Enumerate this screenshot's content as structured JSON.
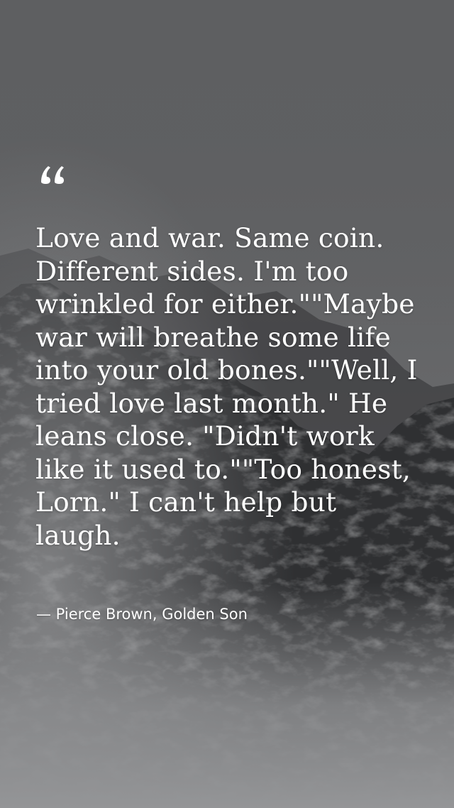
{
  "quote": {
    "text": "Love and war. Same coin. Different sides. I'm too wrinkled for either.\"\"Maybe war will breathe some life into your old bones.\"\"Well, I tried love last month.\" He leans close. \"Didn't work like it used to.\"\"Too honest, Lorn.\" I can't help but laugh.",
    "attribution": "— Pierce Brown, Golden Son",
    "quote_icon": "opening-quotation-mark-icon"
  },
  "background": {
    "description_icon": "misty-mountain-background",
    "colors": {
      "sky": "#5e5f61",
      "rock_dark": "#2b2c2e",
      "mist": "#9a9b9d",
      "text": "#ffffff"
    }
  }
}
